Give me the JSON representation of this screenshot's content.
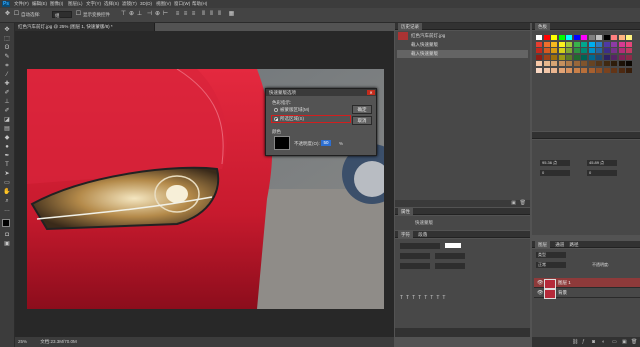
{
  "app": {
    "logo": "Ps"
  },
  "menu": [
    "文件(F)",
    "编辑(E)",
    "图像(I)",
    "图层(L)",
    "文字(Y)",
    "选择(S)",
    "滤镜(T)",
    "3D(D)",
    "视图(V)",
    "窗口(W)",
    "帮助(H)"
  ],
  "options_bar": {
    "autoselect": "自动选择:",
    "group": "组",
    "transform": "显示变换控件"
  },
  "document": {
    "tab": "红色汽车前灯.jpg @ 25% (图层 1, 快速蒙版/8) *",
    "zoom": "25%",
    "doc_info": "文档:23.3M/70.0M"
  },
  "dialog": {
    "title": "快速蒙版选项",
    "section_color_indicates": "色彩指示:",
    "opt_masked": "被蒙版区域(M)",
    "opt_selected": "所选区域(S)",
    "section_color": "颜色",
    "opacity_label": "不透明度(O):",
    "opacity_value": "50",
    "opacity_unit": "%",
    "ok": "确定",
    "cancel": "取消",
    "close": "✕"
  },
  "history": {
    "tab": "历史记录",
    "items": [
      "红色汽车前灯.jpg",
      "载入快速蒙版",
      "载入快速蒙版"
    ]
  },
  "color_panel": {
    "tab": "色板"
  },
  "adjustments": {
    "tab": "属性",
    "sub": "快速蒙版"
  },
  "character": {
    "tab": "字符",
    "sub": "段落",
    "size1": "95.36 点",
    "size2": "45.89 点",
    "tracking": "0"
  },
  "layers": {
    "tab": "图层",
    "tabs": [
      "图层",
      "通道",
      "路径"
    ],
    "kind": "类型",
    "normal": "正常",
    "opacity": "不透明度:",
    "rows": [
      "图层 1",
      "背景"
    ]
  },
  "colors": {
    "canvas_bg": "#282828",
    "dialog_red_border": "#d11f1f",
    "selected_layer": "#8e3a3a",
    "ps_blue": "#31a8ff"
  },
  "swatches": [
    "#ffffff",
    "#ff0000",
    "#ffff00",
    "#00ff00",
    "#00ffff",
    "#0000ff",
    "#ff00ff",
    "#808080",
    "#c0c0c0",
    "#000000",
    "#ff8080",
    "#ffb380",
    "#fff380",
    "#e63d2f",
    "#f06f2c",
    "#f5b91f",
    "#fcf21f",
    "#9ec83a",
    "#39b34a",
    "#00a78e",
    "#00aeef",
    "#2e7cc2",
    "#4e3aa5",
    "#8e3ba6",
    "#d83a92",
    "#e6457a",
    "#c4281c",
    "#d45920",
    "#d69a12",
    "#d4d01a",
    "#7fa834",
    "#2d9241",
    "#008a75",
    "#0090c8",
    "#2667a3",
    "#3d2f88",
    "#76328a",
    "#b52d78",
    "#c23a63",
    "#8f1d14",
    "#9b4118",
    "#9d700d",
    "#9d9913",
    "#5d7b26",
    "#216a2f",
    "#006455",
    "#006993",
    "#1c4b77",
    "#2d2263",
    "#562565",
    "#842158",
    "#8e2a49",
    "#f7c9a8",
    "#e7b88d",
    "#d6a474",
    "#c5905e",
    "#b07c4a",
    "#98673a",
    "#7f542d",
    "#664322",
    "#523519",
    "#402911",
    "#2e1d0b",
    "#1c1106",
    "#0c0702",
    "#f9d8c4",
    "#f2c6a8",
    "#eab58f",
    "#e2a476",
    "#d8925f",
    "#c98049",
    "#b86f3a",
    "#a55f2f",
    "#905026",
    "#7a421e",
    "#633517",
    "#4d2911",
    "#371d0a"
  ]
}
